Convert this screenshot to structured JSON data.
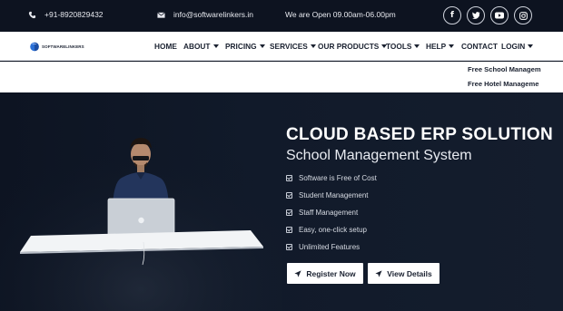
{
  "topbar": {
    "phone": "+91-8920829432",
    "email": "info@softwarelinkers.in",
    "hours": "We are Open 09.00am-06.00pm",
    "social": [
      "facebook-icon",
      "twitter-icon",
      "youtube-icon",
      "instagram-icon"
    ]
  },
  "logo": {
    "text": "SOFTWARELINKERS"
  },
  "nav": {
    "items": [
      {
        "label": "HOME",
        "caret": false
      },
      {
        "label": "ABOUT",
        "caret": true
      },
      {
        "label": "PRICING",
        "caret": true
      },
      {
        "label": "SERVICES",
        "caret": true
      },
      {
        "label": "OUR PRODUCTS",
        "caret": true
      },
      {
        "label": "TOOLS",
        "caret": true
      },
      {
        "label": "HELP",
        "caret": true
      },
      {
        "label": "CONTACT",
        "caret": false
      },
      {
        "label": "LOGIN",
        "caret": true
      }
    ]
  },
  "dropdown": {
    "links": [
      "Free School Managem",
      "Free Hotel Manageme"
    ]
  },
  "hero": {
    "title": "CLOUD BASED ERP SOLUTION",
    "subtitle": "School Management System",
    "features": [
      "Software is Free of Cost",
      "Student Management",
      "Staff Management",
      "Easy, one-click setup",
      "Unlimited Features"
    ],
    "register_label": "Register Now",
    "view_label": "View Details"
  },
  "colors": {
    "hero_bg": "#111a2a",
    "topbar_bg": "#0d1320",
    "nav_bg": "#ffffff",
    "button_bg": "#ffffff",
    "text_dark": "#1a2130"
  }
}
